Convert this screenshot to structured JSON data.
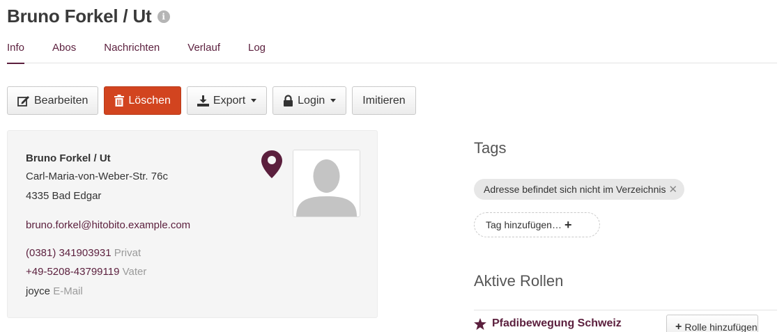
{
  "header": {
    "title": "Bruno Forkel / Ut",
    "info_glyph": "i"
  },
  "tabs": [
    {
      "label": "Info",
      "active": true
    },
    {
      "label": "Abos",
      "active": false
    },
    {
      "label": "Nachrichten",
      "active": false
    },
    {
      "label": "Verlauf",
      "active": false
    },
    {
      "label": "Log",
      "active": false
    }
  ],
  "toolbar": {
    "edit_label": "Bearbeiten",
    "delete_label": "Löschen",
    "export_label": "Export",
    "login_label": "Login",
    "impersonate_label": "Imitieren"
  },
  "person": {
    "name": "Bruno Forkel / Ut",
    "street": "Carl-Maria-von-Weber-Str. 76c",
    "city": "4335 Bad Edgar",
    "email": "bruno.forkel@hitobito.example.com",
    "contacts": [
      {
        "value": "(0381) 341903931",
        "label": "Privat"
      },
      {
        "value": "+49-5208-43799119",
        "label": "Vater"
      },
      {
        "value": "joyce",
        "label": "E-Mail"
      }
    ]
  },
  "tags": {
    "title": "Tags",
    "items": [
      "Adresse befindet sich nicht im Verzeichnis"
    ],
    "remove_glyph": "✕",
    "add_label": "Tag hinzufügen…",
    "add_glyph": "+"
  },
  "roles": {
    "title": "Aktive Rollen",
    "group": "Pfadibewegung Schweiz",
    "add_label": "Rolle hinzufügen",
    "add_glyph": "+"
  },
  "colors": {
    "brand": "#5b1f3d",
    "danger": "#d2441f",
    "tag_bg": "#e7e7e7"
  },
  "icons": {
    "edit": "edit-icon",
    "delete": "trash-icon",
    "export": "download-icon",
    "login": "lock-icon",
    "location": "map-marker-icon",
    "avatar": "user-silhouette",
    "star": "star-icon"
  }
}
